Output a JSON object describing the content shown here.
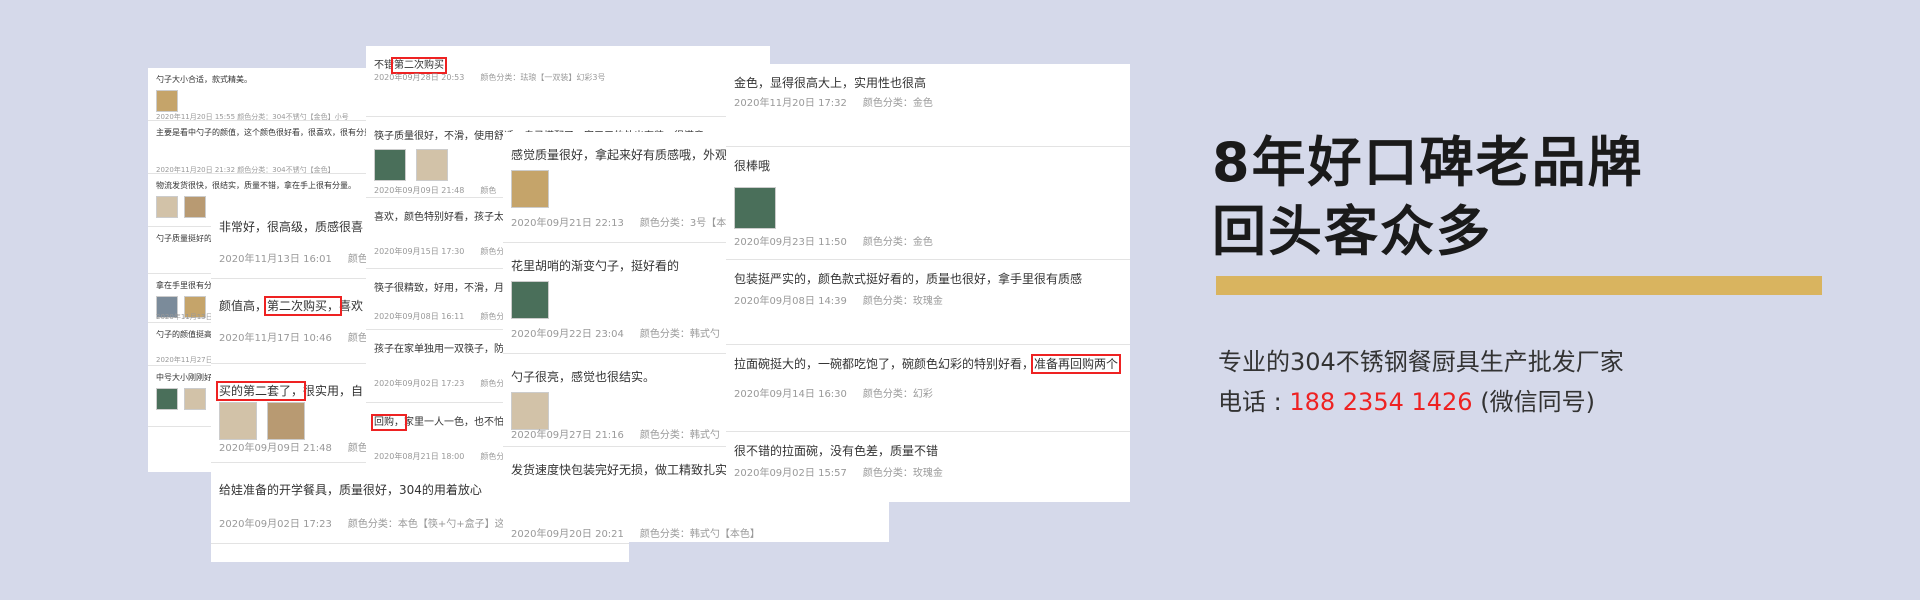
{
  "cards": {
    "c1": [
      {
        "text": "勺子大小合适，款式精美。",
        "meta": "2020年11月20日 15:55    颜色分类：304不锈勺【金色】小号",
        "thumbs": 1
      },
      {
        "text": "主要是看中勺子的颜值，这个颜色很好看，很喜欢，很有分量。",
        "meta": "2020年11月20日 21:32    颜色分类：304不锈勺【金色】",
        "thumbs": 0
      },
      {
        "text": "物流发货很快，很结实，质量不错，拿在手上很有分量。",
        "meta": "",
        "thumbs": 2
      },
      {
        "text": "勺子质量挺好的，",
        "meta": "",
        "thumbs": 0
      },
      {
        "text": "拿在手里很有分量",
        "meta": "2020年11月13日",
        "thumbs": 2
      },
      {
        "text": "勺子的颜值挺高",
        "meta": "2020年11月27日",
        "thumbs": 0
      },
      {
        "text": "中号大小刚刚好",
        "meta": "",
        "thumbs": 2
      }
    ],
    "c2": [
      {
        "text": "非常好，很高级，质感很喜",
        "meta": "2020年11月13日 16:01",
        "cat": "颜色"
      },
      {
        "pre": "颜值高，",
        "hl": "第二次购买，",
        "post": "喜欢",
        "meta": "2020年11月17日 10:46",
        "cat": "颜色"
      },
      {
        "hl": "买的第二套了，",
        "post": "很实用，自",
        "meta": "2020年09月09日 21:48",
        "cat": "颜色分类：本色【筷+勺+盒子】"
      },
      {
        "text": "给娃准备的开学餐具，质量很好，304的用着放心",
        "meta": "2020年09月02日 17:23",
        "cat": "颜色分类：本色【筷+勺+盒子】这"
      }
    ],
    "c3": [
      {
        "pre": "不错",
        "hl": "第二次购买",
        "meta": "2020年09月28日 20:53",
        "cat": "颜色分类：珐琅【一双装】幻彩3号"
      },
      {
        "text": "筷子质量很好，不滑，使用舒适，自己搭配了一家三口的外出套装，很满意!",
        "meta": "2020年09月09日 21:48",
        "cat": "颜色"
      },
      {
        "text": "喜欢，颜色特别好看，孩子太",
        "meta": "2020年09月15日 17:30",
        "cat": "颜色分"
      },
      {
        "text": "筷子很精致，好用，不滑，月",
        "meta": "2020年09月08日 16:11",
        "cat": "颜色分"
      },
      {
        "text": "孩子在家单独用一双筷子，防",
        "meta": "2020年09月02日 17:23",
        "cat": "颜色分"
      },
      {
        "hl": "回购，",
        "post": "家里一人一色，也不怕",
        "meta": "2020年08月21日 18:00",
        "cat": "颜色分"
      }
    ],
    "c4": [
      {
        "text": "感觉质量很好，拿起来好有质感哦，外观",
        "meta": "2020年09月21日 22:13",
        "cat": "颜色分类：3号【本色"
      },
      {
        "text": "花里胡哨的渐变勺子，挺好看的",
        "meta": "2020年09月22日 23:04",
        "cat": "颜色分类：韩式勺【本色】"
      },
      {
        "text": "勺子很亮，感觉也很结实。",
        "meta": "2020年09月27日 21:16",
        "cat": "颜色分类：韩式勺【本"
      },
      {
        "text": "发货速度快包装完好无损，做工精致扎实",
        "meta": "2020年09月20日 20:21",
        "cat": "颜色分类：韩式勺【本色】"
      }
    ],
    "c5": [
      {
        "text": "金色，显得很高大上，实用性也很高",
        "meta": "2020年11月20日 17:32",
        "cat": "颜色分类：金色"
      },
      {
        "text": "很棒哦",
        "meta": "2020年09月23日 11:50",
        "cat": "颜色分类：金色"
      },
      {
        "text": "包装挺严实的，颜色款式挺好看的，质量也很好，拿手里很有质感",
        "meta": "2020年09月08日 14:39",
        "cat": "颜色分类：玫瑰金"
      },
      {
        "pre": "拉面碗挺大的，一碗都吃饱了，碗颜色幻彩的特别好看，",
        "hl": "准备再回购两个",
        "meta": "2020年09月14日 16:30",
        "cat": "颜色分类：幻彩"
      },
      {
        "text": "很不错的拉面碗，没有色差，质量不错",
        "meta": "2020年09月02日 15:57",
        "cat": "颜色分类：玫瑰金"
      }
    ]
  },
  "promo": {
    "title_line1": "8年好口碑老品牌",
    "title_line2": "回头客众多",
    "desc_line1": "专业的304不锈钢餐厨具生产批发厂家",
    "phone_label": "电话 : ",
    "phone_number": "188 2354 1426",
    "phone_note": " (微信同号)"
  },
  "colors": {
    "highlight": "#e22222",
    "gold": "#d9b45f",
    "background": "#d5d9ea"
  }
}
